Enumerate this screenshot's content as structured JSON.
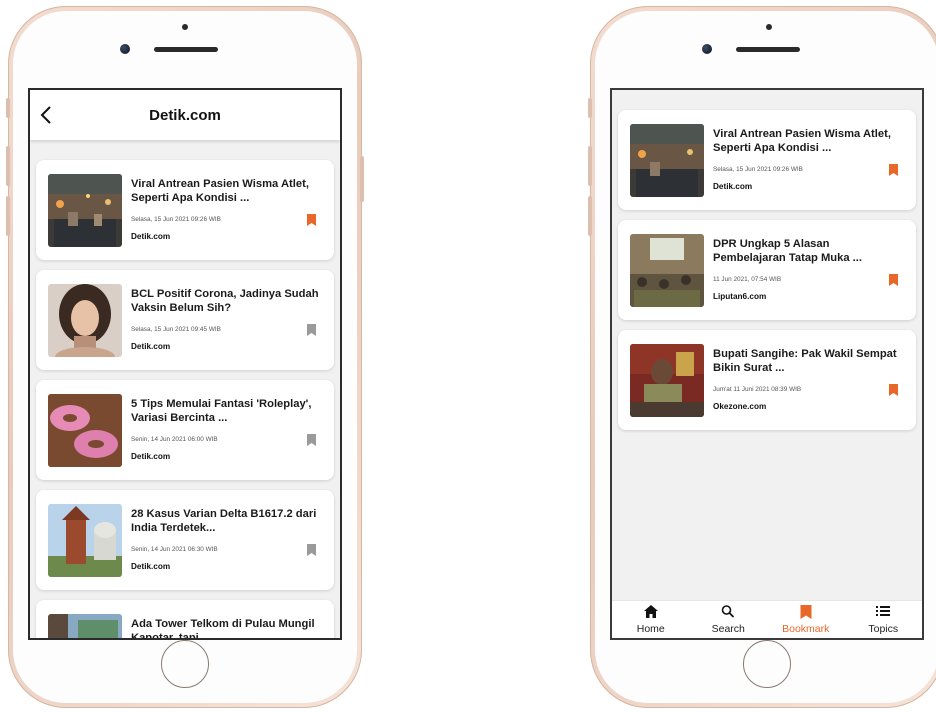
{
  "left_screen": {
    "header": {
      "title": "Detik.com",
      "back_icon": "chevron-left-icon"
    },
    "articles": [
      {
        "title": "Viral Antrean Pasien Wisma Atlet, Seperti Apa Kondisi ...",
        "date": "Selasa, 15 Jun 2021 09:26 WIB",
        "source": "Detik.com",
        "bookmarked": true
      },
      {
        "title": "BCL Positif Corona, Jadinya Sudah Vaksin Belum Sih?",
        "date": "Selasa, 15 Jun 2021 09:45 WIB",
        "source": "Detik.com",
        "bookmarked": false
      },
      {
        "title": "5 Tips Memulai Fantasi 'Roleplay', Variasi Bercinta ...",
        "date": "Senin, 14 Jun 2021 06:00 WIB",
        "source": "Detik.com",
        "bookmarked": false
      },
      {
        "title": "28 Kasus Varian Delta B1617.2 dari India Terdetek...",
        "date": "Senin, 14 Jun 2021 06:30 WIB",
        "source": "Detik.com",
        "bookmarked": false
      },
      {
        "title": "Ada Tower Telkom di Pulau Mungil Kapotar, tapi",
        "date": "",
        "source": "",
        "bookmarked": false
      }
    ]
  },
  "right_screen": {
    "articles": [
      {
        "title": "Viral Antrean Pasien Wisma Atlet, Seperti Apa Kondisi ...",
        "date": "Selasa, 15 Jun 2021 09:26 WIB",
        "source": "Detik.com",
        "bookmarked": true
      },
      {
        "title": "DPR Ungkap 5 Alasan Pembelajaran Tatap Muka ...",
        "date": "11 Jun 2021, 07:54 WIB",
        "source": "Liputan6.com",
        "bookmarked": true
      },
      {
        "title": "Bupati Sangihe: Pak Wakil Sempat Bikin Surat ...",
        "date": "Jum'at 11 Juni 2021 08:39 WIB",
        "source": "Okezone.com",
        "bookmarked": true
      }
    ],
    "bottom_nav": [
      {
        "label": "Home",
        "icon": "home-icon",
        "active": false
      },
      {
        "label": "Search",
        "icon": "search-icon",
        "active": false
      },
      {
        "label": "Bookmark",
        "icon": "bookmark-icon",
        "active": true
      },
      {
        "label": "Topics",
        "icon": "list-icon",
        "active": false
      }
    ]
  },
  "colors": {
    "accent": "#e8682a",
    "bookmark_inactive": "#9a9a9a",
    "frame": "#ebcfbf"
  }
}
